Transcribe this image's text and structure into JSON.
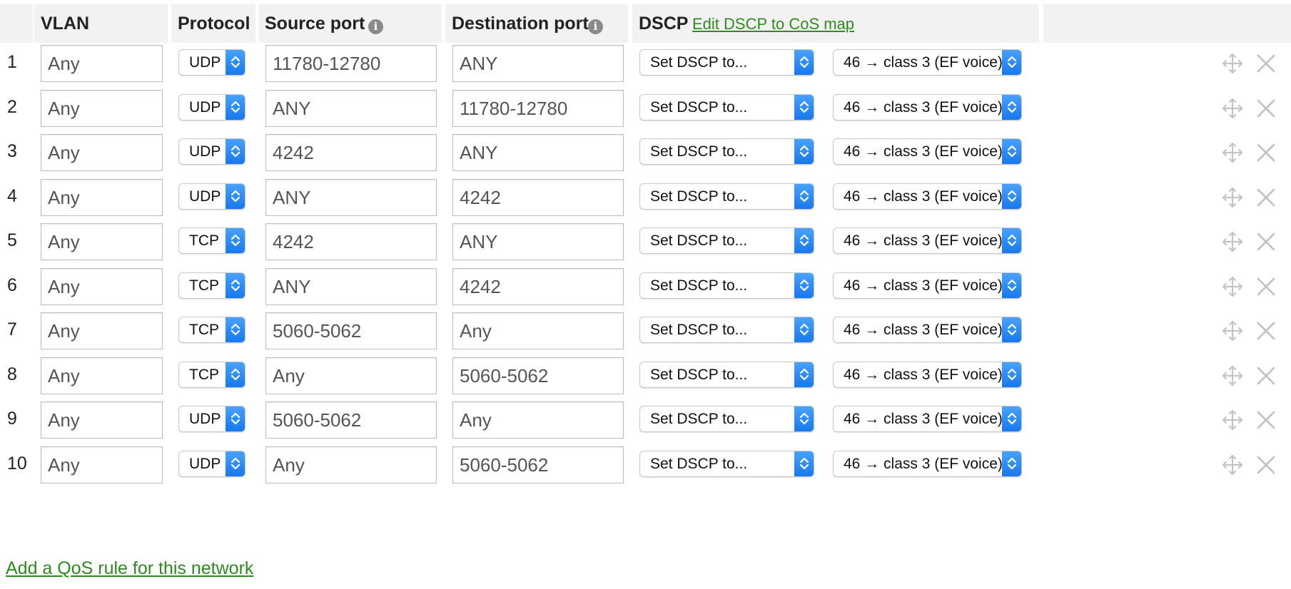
{
  "table": {
    "headers": {
      "vlan": "VLAN",
      "protocol": "Protocol",
      "source_port": "Source port",
      "destination_port": "Destination port",
      "dscp": "DSCP",
      "edit_dscp_link": "Edit DSCP to CoS map"
    },
    "rows": [
      {
        "num": "1",
        "vlan": "Any",
        "protocol": "UDP",
        "source_port": "11780-12780",
        "destination_port": "ANY",
        "dscp_action": "Set DSCP to...",
        "dscp_value": "46 → class 3 (EF voice)"
      },
      {
        "num": "2",
        "vlan": "Any",
        "protocol": "UDP",
        "source_port": "ANY",
        "destination_port": "11780-12780",
        "dscp_action": "Set DSCP to...",
        "dscp_value": "46 → class 3 (EF voice)"
      },
      {
        "num": "3",
        "vlan": "Any",
        "protocol": "UDP",
        "source_port": "4242",
        "destination_port": "ANY",
        "dscp_action": "Set DSCP to...",
        "dscp_value": "46 → class 3 (EF voice)"
      },
      {
        "num": "4",
        "vlan": "Any",
        "protocol": "UDP",
        "source_port": "ANY",
        "destination_port": "4242",
        "dscp_action": "Set DSCP to...",
        "dscp_value": "46 → class 3 (EF voice)"
      },
      {
        "num": "5",
        "vlan": "Any",
        "protocol": "TCP",
        "source_port": "4242",
        "destination_port": "ANY",
        "dscp_action": "Set DSCP to...",
        "dscp_value": "46 → class 3 (EF voice)"
      },
      {
        "num": "6",
        "vlan": "Any",
        "protocol": "TCP",
        "source_port": "ANY",
        "destination_port": "4242",
        "dscp_action": "Set DSCP to...",
        "dscp_value": "46 → class 3 (EF voice)"
      },
      {
        "num": "7",
        "vlan": "Any",
        "protocol": "TCP",
        "source_port": "5060-5062",
        "destination_port": "Any",
        "dscp_action": "Set DSCP to...",
        "dscp_value": "46 → class 3 (EF voice)"
      },
      {
        "num": "8",
        "vlan": "Any",
        "protocol": "TCP",
        "source_port": "Any",
        "destination_port": "5060-5062",
        "dscp_action": "Set DSCP to...",
        "dscp_value": "46 → class 3 (EF voice)"
      },
      {
        "num": "9",
        "vlan": "Any",
        "protocol": "UDP",
        "source_port": "5060-5062",
        "destination_port": "Any",
        "dscp_action": "Set DSCP to...",
        "dscp_value": "46 → class 3 (EF voice)"
      },
      {
        "num": "10",
        "vlan": "Any",
        "protocol": "UDP",
        "source_port": "Any",
        "destination_port": "5060-5062",
        "dscp_action": "Set DSCP to...",
        "dscp_value": "46 → class 3 (EF voice)"
      }
    ]
  },
  "add_rule_link": "Add a QoS rule for this network",
  "icons": {
    "info": "info-icon",
    "move": "move-icon",
    "delete": "close-icon",
    "select_arrow": "chevron-up-down-icon"
  },
  "colors": {
    "link": "#2e8b1e",
    "header_bg": "#f2f2f2",
    "select_arrow": "#1e88f5",
    "row_icon": "#c4c4c4"
  }
}
